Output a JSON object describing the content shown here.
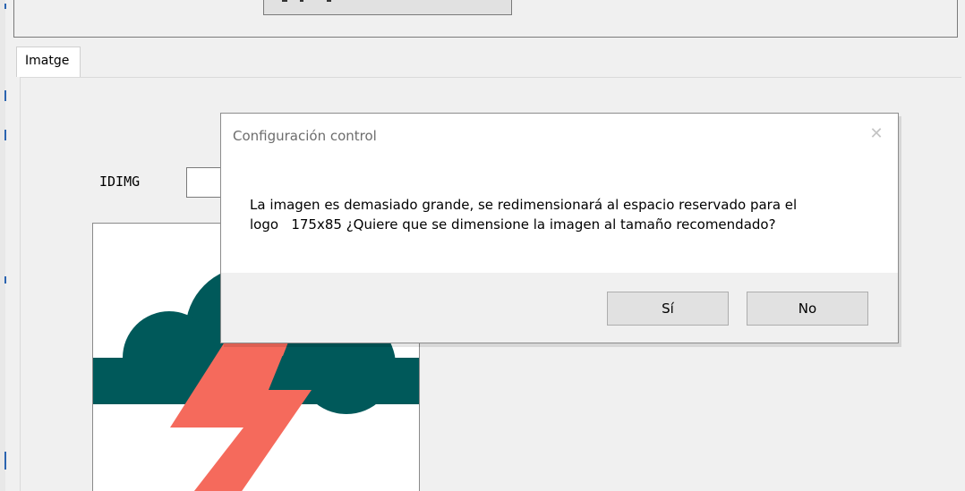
{
  "tabs": [
    {
      "label": "Imatge",
      "selected": true
    }
  ],
  "form": {
    "idimg_label": "IDIMG",
    "idimg_value": ""
  },
  "image": {
    "description_icon": "cloud-lightning-icon",
    "cloud_color": "#00595a",
    "bolt_color": "#f56a5c"
  },
  "dialog": {
    "title": "Configuración control",
    "close_glyph": "✕",
    "message_line1": "La imagen es demasiado grande, se redimensionará al espacio reservado para el",
    "message_line2": "logo   175x85 ¿Quiere que se dimensione la imagen al tamaño recomendado?",
    "yes_label": "Sí",
    "no_label": "No"
  },
  "colors": {
    "window_bg": "#f0f0f0",
    "dialog_bg": "#ffffff",
    "button_bg": "#e1e1e1"
  }
}
